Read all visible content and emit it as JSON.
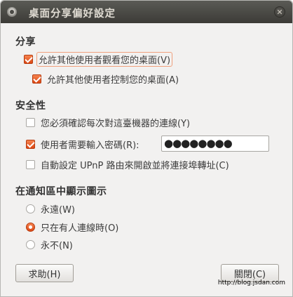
{
  "window": {
    "title": "桌面分享偏好設定"
  },
  "sharing": {
    "heading": "分享",
    "allow_view": {
      "label": "允許其他使用者觀看您的桌面(V)",
      "checked": true
    },
    "allow_control": {
      "label": "允許其他使用者控制您的桌面(A)",
      "checked": true
    }
  },
  "security": {
    "heading": "安全性",
    "confirm_each": {
      "label": "您必須確認每次對這臺機器的連線(Y)",
      "checked": false
    },
    "require_password": {
      "label": "使用者需要輸入密碼(R):",
      "checked": true
    },
    "password_value": "●●●●●●●●",
    "upnp": {
      "label": "自動設定 UPnP 路由來開啟並將連接埠轉址(C)",
      "checked": false
    }
  },
  "notify": {
    "heading": "在通知區中顯示圖示",
    "options": [
      {
        "label": "永遠(W)",
        "selected": false
      },
      {
        "label": "只在有人連線時(O)",
        "selected": true
      },
      {
        "label": "永不(N)",
        "selected": false
      }
    ]
  },
  "buttons": {
    "help": "求助(H)",
    "close": "關閉(C)"
  },
  "watermark": "http://blog.jsdan.com",
  "colors": {
    "accent": "#dd4814",
    "titlebar": "#3c3b37",
    "window_bg": "#f2f1f0"
  }
}
